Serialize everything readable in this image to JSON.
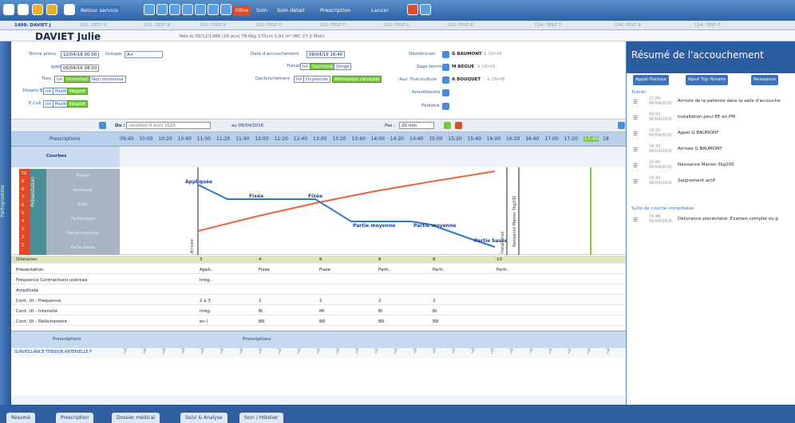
{
  "toolbar": {
    "retour": "Retour service",
    "filtre": "Filtre",
    "soin": "Soin",
    "soin_detail": "Soin détail",
    "prescription": "Prescription",
    "lancer": "Lancer"
  },
  "tabs": [
    "1498: DAVIET J",
    "152: TEST 0",
    "152: TEST 8",
    "152: TEST 9",
    "152: TEST F",
    "152: TEST F",
    "152: TEST L",
    "152: TEST E",
    "154: TEST 7",
    "154: TEST 6",
    "154: TEST F"
  ],
  "patient": {
    "name": "DAVIET Julie",
    "info": "Née le 05/12/1988 (29 ans)   78.0kg   170cm   1,91 m²   IMC 27,0   Mahl"
  },
  "form": {
    "terme_label": "Terme prévu",
    "terme_val": "12/04/18 00:00",
    "groupe_label": "Groupe",
    "groupe_val": "A+",
    "rpm_label": "RPM",
    "rpm_val": "06/04/16 08:00",
    "toxo_label": "Toxo",
    "toxo_opts": [
      "Int",
      "Immunisé",
      "Non immunisé"
    ],
    "strepto_label": "Strepto B",
    "strepto_opts": [
      "Int",
      "Positif",
      "Négatif"
    ],
    "ecoli_label": "E.Coli",
    "ecoli_opts": [
      "Int",
      "Positif",
      "Négatif"
    ],
    "date_acc_label": "Date d'accouchement",
    "date_acc_val": "08/04/16 16:40",
    "travail_label": "Travail",
    "travail_opts": [
      "Int",
      "Spontané",
      "Dirigé"
    ],
    "declench_label": "Déclenchement",
    "declench_opts": [
      "Int",
      "Ocytocine",
      "Maturation cervicale"
    ],
    "obst_label": "Obstétricien",
    "obst_val": "G BAUMONT",
    "obst_time": "à 16h48",
    "sf_label": "Sage-femme",
    "sf_val": "M BEGUE",
    "sf_time": "à 16h48",
    "aux_label": "Aux. Puériculture",
    "aux_val": "A BOUQUET",
    "aux_time": "à 16h48",
    "anest_label": "Anesthésiste",
    "ped_label": "Pédiatre"
  },
  "controls": {
    "du": "Du :",
    "date": "vendredi 8 avril 2016",
    "au": "au 09/04/2016",
    "pas_label": "Pas :",
    "pas_val": "20 min."
  },
  "times": [
    "09:40",
    "10:00",
    "10:20",
    "10:40",
    "11:00",
    "11:20",
    "11:40",
    "12:00",
    "12:20",
    "12:40",
    "13:00",
    "13:20",
    "13:40",
    "14:00",
    "14:20",
    "14:40",
    "15:00",
    "15:20",
    "15:40",
    "16:00",
    "16:20",
    "16:40",
    "17:00",
    "17:20",
    "17:40",
    "18"
  ],
  "headers": {
    "prescriptions": "Prescriptions",
    "courbes": "Courbes",
    "presentation": "Présentation",
    "side": "Partogramme"
  },
  "scale": [
    "10",
    "9",
    "8",
    "7",
    "6",
    "5",
    "4",
    "3",
    "2",
    "1"
  ],
  "curve_labels": {
    "applique": "Appliquée",
    "fixee1": "Fixée",
    "fixee2": "Fixée",
    "partie1": "Partie moyenne",
    "partie2": "Partie moyenne",
    "partie3": "Partie basse",
    "arrivee": "Arrivée",
    "inst": "Installation",
    "naissance": "Naissance Manon 3kg200"
  },
  "presentation_items": [
    "Mobile",
    "Appliquée",
    "Fixée",
    "Partie haute",
    "Partie moyenne",
    "Partie basse"
  ],
  "table": [
    {
      "label": "Dilatation",
      "v": [
        "3",
        "4",
        "6",
        "8",
        "8",
        "10"
      ]
    },
    {
      "label": "Présentation",
      "v": [
        "Appli..",
        "Fixée",
        "Fixée",
        "Parti..",
        "Parti..",
        "Parti.."
      ]
    },
    {
      "label": "Fréquence Contractions utérines",
      "v": [
        "Irrég..",
        "",
        "",
        "",
        "",
        ""
      ]
    },
    {
      "label": "Amplitude",
      "v": [
        "",
        "",
        "",
        "",
        "",
        ""
      ]
    },
    {
      "label": "Cont. Ut - Fréquence",
      "v": [
        "2 à 3",
        "2",
        "2",
        "2",
        "2",
        ""
      ]
    },
    {
      "label": "Cont. Ut - Intensité",
      "v": [
        "Irrég..",
        "Bi",
        "Mi",
        "Bi",
        "Bi",
        ""
      ]
    },
    {
      "label": "Cont. Ut - Relâchement",
      "v": [
        "en l",
        "BR",
        "BR",
        "BR",
        "BR",
        ""
      ]
    }
  ],
  "presc": {
    "left": "Prescriptions",
    "right": "Prescriptions",
    "row": "SURVEILLANCE TENSION ARTERIELLE F",
    "mark": "?"
  },
  "bottom_tabs": [
    "Résumé",
    "Prescription",
    "Dossier médical",
    "Suivi & Analyse",
    "Soin / Hôtelier"
  ],
  "right": {
    "title": "Résumé de l'accouchement",
    "btn1": "Appel Docteur",
    "btn2": "Ajout Top Horaire",
    "btn3": "Naissance",
    "travail": "Travail",
    "events": [
      {
        "time": "11:00",
        "date": "06/04/2016",
        "text": "Arrivée de la patiente dans la salle d'accouche"
      },
      {
        "time": "09:55",
        "date": "06/04/2016",
        "text": "Installation pour EE en PM"
      },
      {
        "time": "16:20",
        "date": "06/04/2016",
        "text": "Appel G BAUMONT"
      },
      {
        "time": "16:30",
        "date": "06/04/2016",
        "text": "Arrivée G BAUMONT"
      },
      {
        "time": "16:40",
        "date": "06/04/2016",
        "text": "Naissance Manon 3kg200"
      },
      {
        "time": "16:45",
        "date": "06/04/2016",
        "text": "Saignement actif"
      }
    ],
    "suite": "Suite de couche immédiates",
    "suite_events": [
      {
        "time": "16:46",
        "date": "06/04/2016",
        "text": "Délivrance placentaire: Examen complet ou p"
      }
    ]
  },
  "colors": {
    "accent": "#2b5da3",
    "green": "#78c840",
    "red": "#e04a2a",
    "teal": "#4a8e96"
  }
}
